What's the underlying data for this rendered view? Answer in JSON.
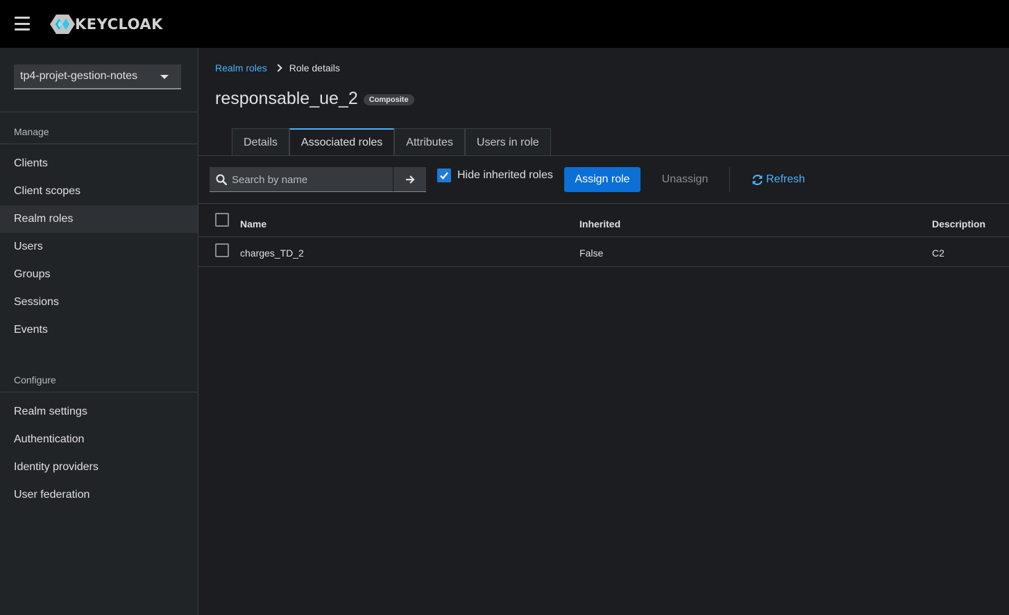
{
  "header": {
    "brand": "KEYCLOAK"
  },
  "sidebar": {
    "realm": "tp4-projet-gestion-notes",
    "sections": [
      {
        "title": "Manage",
        "items": [
          "Clients",
          "Client scopes",
          "Realm roles",
          "Users",
          "Groups",
          "Sessions",
          "Events"
        ]
      },
      {
        "title": "Configure",
        "items": [
          "Realm settings",
          "Authentication",
          "Identity providers",
          "User federation"
        ]
      }
    ],
    "active_item": "Realm roles"
  },
  "breadcrumb": {
    "parent": "Realm roles",
    "current": "Role details"
  },
  "page": {
    "title": "responsable_ue_2",
    "badge": "Composite"
  },
  "tabs": [
    "Details",
    "Associated roles",
    "Attributes",
    "Users in role"
  ],
  "active_tab": "Associated roles",
  "toolbar": {
    "search_placeholder": "Search by name",
    "search_value": "",
    "hide_inherited_label": "Hide inherited roles",
    "hide_inherited_checked": true,
    "assign_label": "Assign role",
    "unassign_label": "Unassign",
    "refresh_label": "Refresh"
  },
  "table": {
    "columns": [
      "Name",
      "Inherited",
      "Description"
    ],
    "rows": [
      {
        "name": "charges_TD_2",
        "inherited": "False",
        "description": "C2"
      }
    ]
  },
  "colors": {
    "accent": "#0b6fd6",
    "link": "#4bb3fd",
    "background": "#1b1d21",
    "sidebar": "#212427",
    "header": "#000000"
  }
}
